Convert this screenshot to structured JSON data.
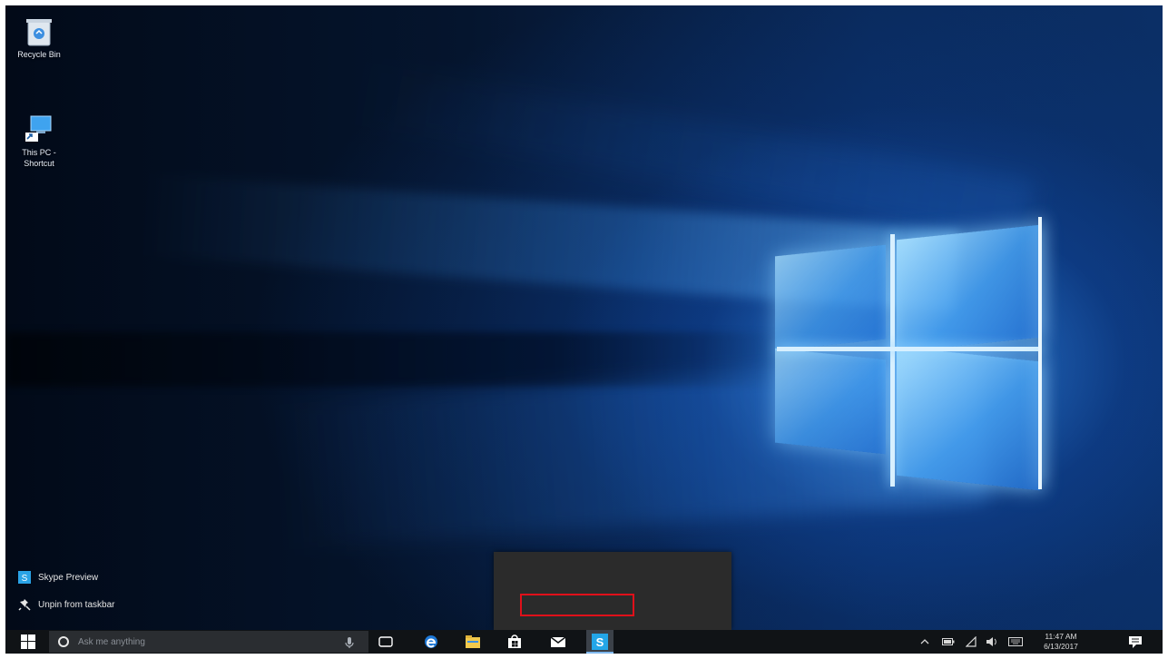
{
  "desktop": {
    "icons": [
      {
        "label": "Recycle Bin",
        "icon": "recycle-bin-icon"
      },
      {
        "label": "This PC - Shortcut",
        "icon": "this-pc-icon"
      }
    ]
  },
  "jumplist": {
    "items": [
      {
        "label": "Skype Preview",
        "icon": "skype-icon"
      },
      {
        "label": "Unpin from taskbar",
        "icon": "unpin-icon"
      }
    ],
    "highlight_color": "#e0101a"
  },
  "taskbar": {
    "search_placeholder": "Ask me anything",
    "apps": [
      {
        "name": "Task View",
        "icon": "task-view-icon"
      },
      {
        "name": "Microsoft Edge",
        "icon": "edge-icon"
      },
      {
        "name": "File Explorer",
        "icon": "file-explorer-icon"
      },
      {
        "name": "Store",
        "icon": "store-icon"
      },
      {
        "name": "Mail",
        "icon": "mail-icon"
      },
      {
        "name": "Skype Preview",
        "icon": "skype-icon",
        "active": true
      }
    ],
    "clock": {
      "time": "11:47 AM",
      "date": "6/13/2017"
    }
  },
  "colors": {
    "taskbar_bg": "#101316",
    "search_bg": "#2a2d31",
    "jumplist_bg": "#2b2b2b",
    "accent": "#1e90e8"
  }
}
